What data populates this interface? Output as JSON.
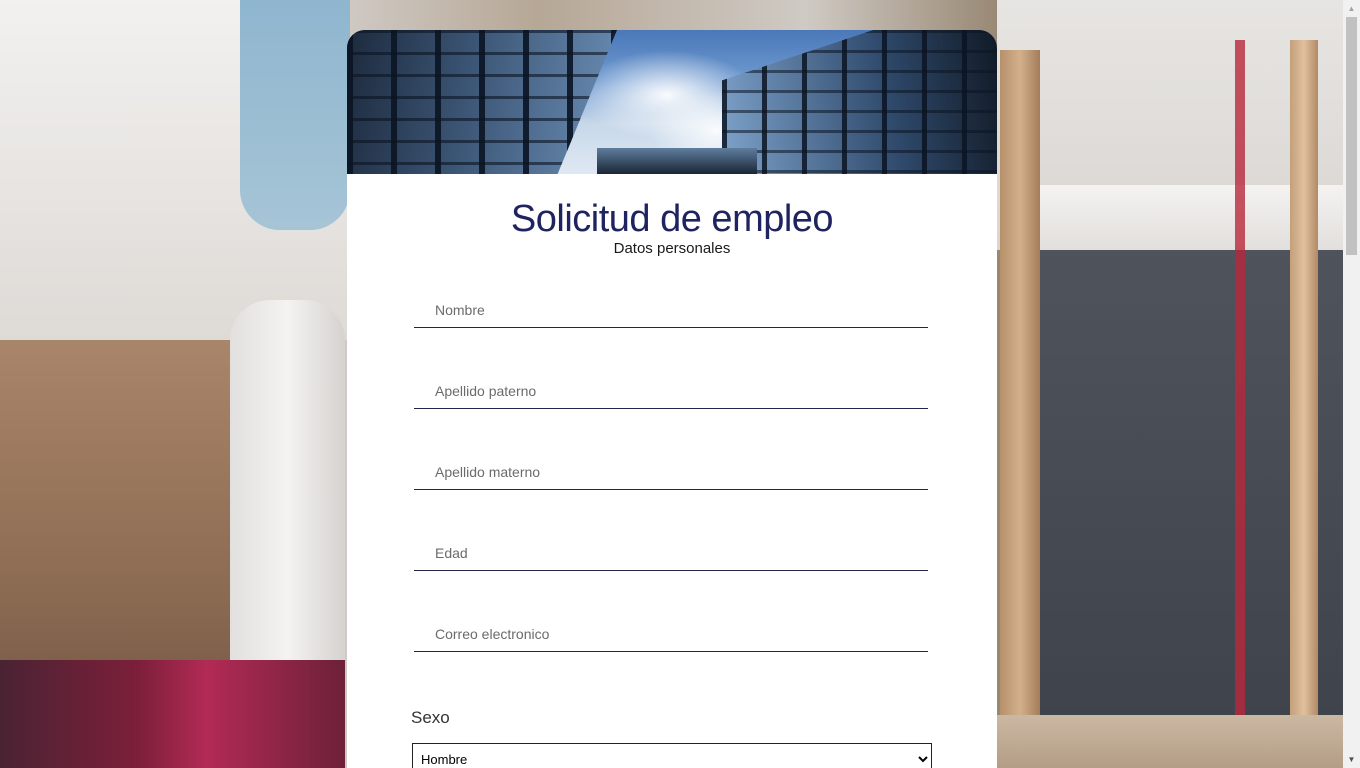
{
  "form": {
    "title": "Solicitud de empleo",
    "subtitle": "Datos personales",
    "fields": {
      "nombre_placeholder": "Nombre",
      "apellido_paterno_placeholder": "Apellido paterno",
      "apellido_materno_placeholder": "Apellido materno",
      "edad_placeholder": "Edad",
      "correo_placeholder": "Correo electronico"
    },
    "sexo": {
      "label": "Sexo",
      "selected": "Hombre"
    }
  },
  "colors": {
    "title": "#1f2461",
    "field_underline": "#23254a"
  }
}
